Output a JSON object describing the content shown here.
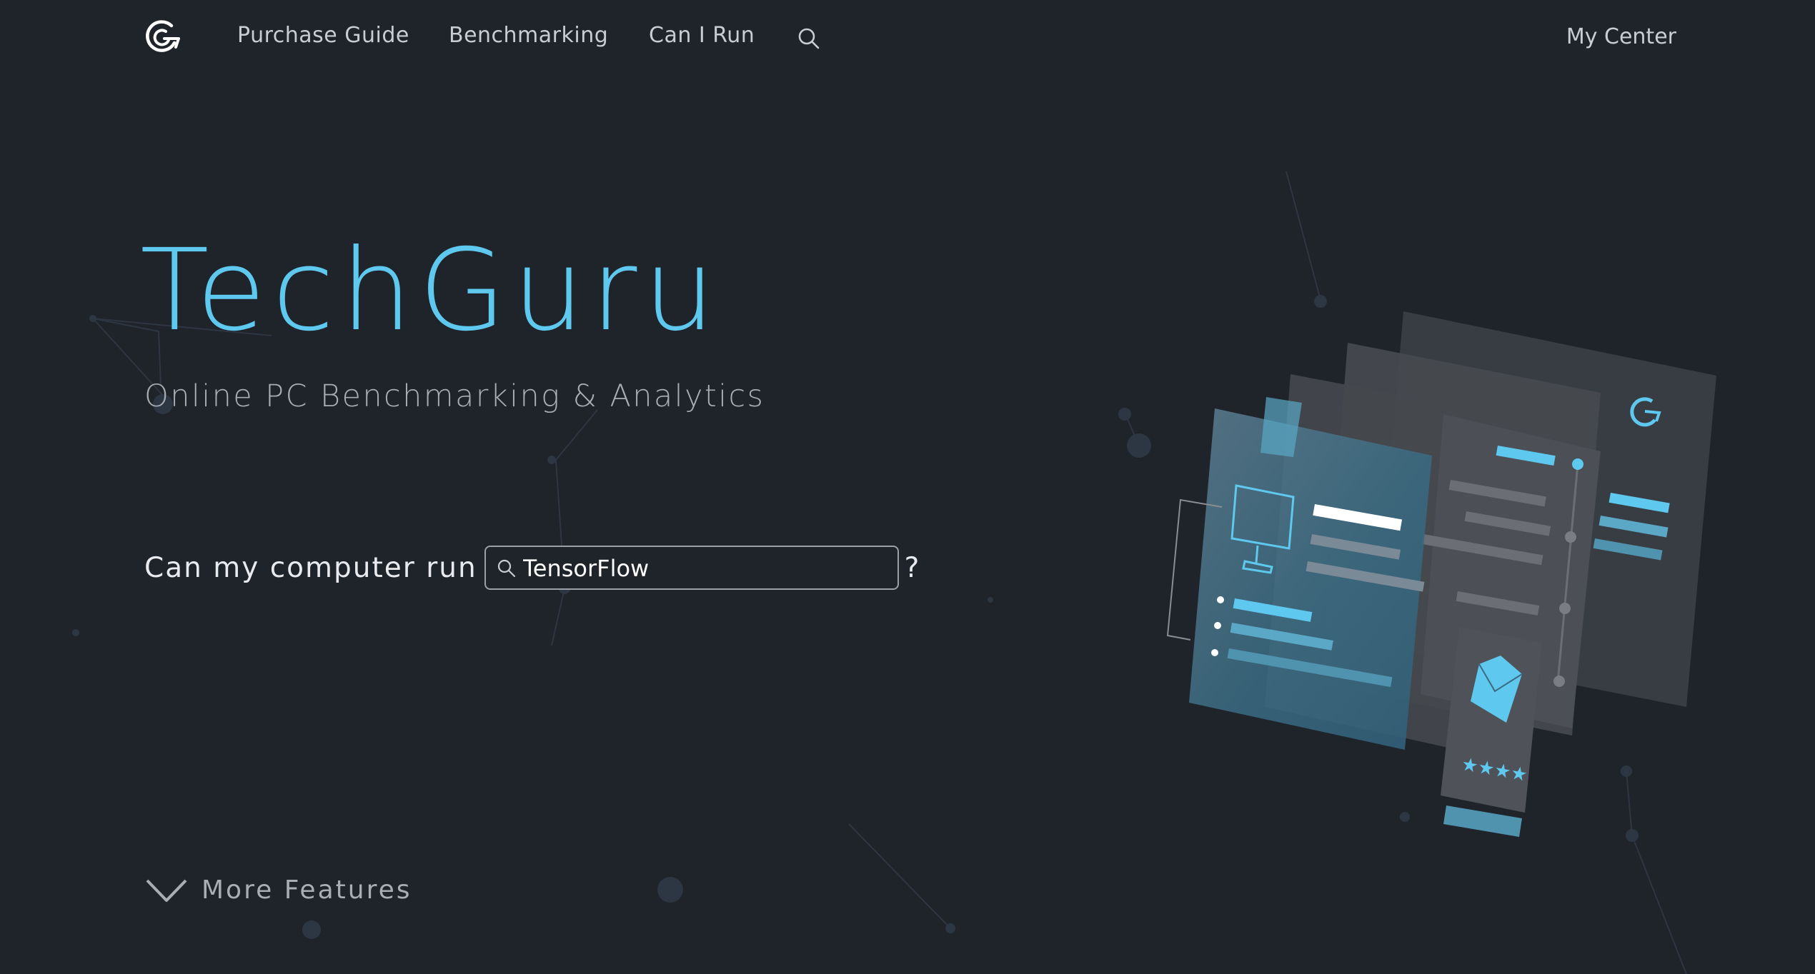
{
  "nav": {
    "logo": "techguru-logo-icon",
    "links": [
      "Purchase Guide",
      "Benchmarking",
      "Can I Run"
    ],
    "search_icon": "search-icon",
    "my_center": "My Center"
  },
  "hero": {
    "title": "TechGuru",
    "subtitle": "Online PC Benchmarking & Analytics",
    "question_prefix": "Can my computer run",
    "search_value": "TensorFlow",
    "question_suffix": "?"
  },
  "more_features": {
    "label": "More Features",
    "icon": "chevron-down-icon"
  },
  "colors": {
    "background": "#1f232a",
    "accent": "#5ec8ee",
    "nav_text": "#c9ccd1",
    "subtitle_text": "#a9adb4"
  }
}
